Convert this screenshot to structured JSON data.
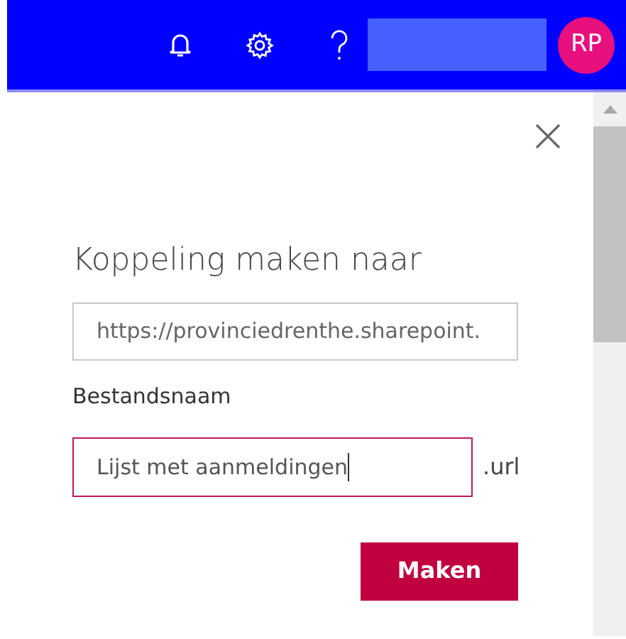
{
  "header": {
    "avatar": "RP"
  },
  "dialog": {
    "title": "Koppeling maken naar",
    "url_field": {
      "value": "https://provinciedrenthe.sharepoint."
    },
    "filename_label": "Bestandsnaam",
    "filename_field": {
      "value": "Lijst met aanmeldingen",
      "focused": true
    },
    "extension": ".url",
    "buttons": [
      "Maken"
    ]
  }
}
